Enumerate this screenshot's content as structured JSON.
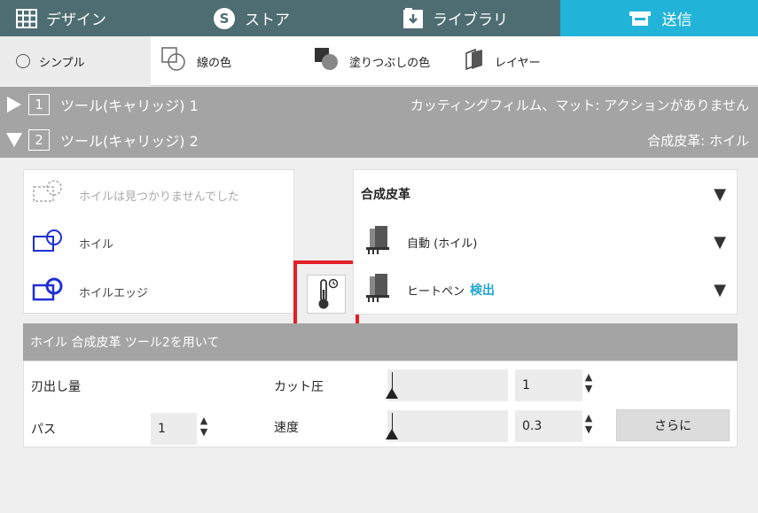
{
  "nav": {
    "design": "デザイン",
    "store": "ストア",
    "library": "ライブラリ",
    "send": "送信"
  },
  "toolbar": {
    "simple": "シンプル",
    "line_color": "線の色",
    "fill_color": "塗りつぶしの色",
    "layer": "レイヤー"
  },
  "tools": [
    {
      "number": "1",
      "label": "ツール(キャリッジ) 1",
      "status": "カッティングフィルム、マット: アクションがありません",
      "expanded": false
    },
    {
      "number": "2",
      "label": "ツール(キャリッジ) 2",
      "status": "合成皮革: ホイル",
      "expanded": true
    }
  ],
  "blade_options": {
    "not_found": "ホイルは見つかりませんでした",
    "foil": "ホイル",
    "foil_edge": "ホイルエッジ"
  },
  "material": {
    "name": "合成皮革",
    "mode": "自動 (ホイル)",
    "pen": "ヒートペン",
    "detect": "検出"
  },
  "info_header": "ホイル 合成皮革 ツール2を用いて",
  "settings": {
    "blade_depth_label": "刃出し量",
    "passes_label": "パス",
    "passes_value": "1",
    "force_label": "カット圧",
    "force_value": "1",
    "speed_label": "速度",
    "speed_value": "0.3",
    "more_button": "さらに"
  },
  "colors": {
    "nav_bg": "#4d6d73",
    "nav_active": "#22b3d8",
    "header_gray": "#a4a4a4",
    "highlight_red": "#e21f26",
    "detect_blue": "#22a7d0",
    "blade_blue": "#1f2fd6"
  }
}
